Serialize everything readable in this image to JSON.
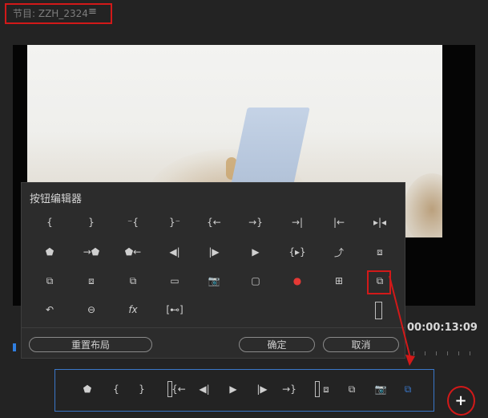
{
  "header": {
    "title": "节目: ZZH_2324",
    "menu_icon": "hamburger-menu-icon"
  },
  "monitor": {
    "timecode": "00:00:13:09"
  },
  "dialog": {
    "title": "按钮编辑器",
    "reset_label": "重置布局",
    "ok_label": "确定",
    "cancel_label": "取消",
    "fx_label": "fx",
    "buttons": [
      {
        "icon": "add-marker-in-icon",
        "glyph": "{"
      },
      {
        "icon": "add-marker-out-icon",
        "glyph": "}"
      },
      {
        "icon": "clear-in-icon",
        "glyph": "⁻{"
      },
      {
        "icon": "clear-out-icon",
        "glyph": "}⁻"
      },
      {
        "icon": "go-to-in-icon",
        "glyph": "{←"
      },
      {
        "icon": "go-to-out-icon",
        "glyph": "→}"
      },
      {
        "icon": "go-to-next-edit-icon",
        "glyph": "→|"
      },
      {
        "icon": "go-to-prev-edit-icon",
        "glyph": "|←"
      },
      {
        "icon": "trim-edit-icon",
        "glyph": "▸|◂"
      },
      {
        "icon": "add-marker-icon",
        "glyph": "⬟"
      },
      {
        "icon": "go-to-next-marker-icon",
        "glyph": "→⬟"
      },
      {
        "icon": "go-to-prev-marker-icon",
        "glyph": "⬟←"
      },
      {
        "icon": "step-back-icon",
        "glyph": "◀|"
      },
      {
        "icon": "step-forward-icon",
        "glyph": "|▶"
      },
      {
        "icon": "play-icon",
        "glyph": "▶"
      },
      {
        "icon": "play-in-to-out-icon",
        "glyph": "{▸}"
      },
      {
        "icon": "play-around-icon",
        "glyph": "⤴"
      },
      {
        "icon": "lift-icon",
        "glyph": "⧈"
      },
      {
        "icon": "extract-icon",
        "glyph": "⧉"
      },
      {
        "icon": "insert-icon",
        "glyph": "⧈"
      },
      {
        "icon": "overwrite-icon",
        "glyph": "⧉"
      },
      {
        "icon": "safe-margins-icon",
        "glyph": "▭"
      },
      {
        "icon": "export-frame-icon",
        "glyph": "📷"
      },
      {
        "icon": "closed-captions-icon",
        "glyph": "▢"
      },
      {
        "icon": "record-icon",
        "glyph": "●"
      },
      {
        "icon": "multi-camera-icon",
        "glyph": "⊞"
      },
      {
        "icon": "comparison-view-icon",
        "glyph": "⧉"
      },
      {
        "icon": "undo-icon",
        "glyph": "↶"
      },
      {
        "icon": "vr-video-icon",
        "glyph": "⊖"
      },
      {
        "icon": "fx-bypass-icon",
        "glyph": "fx"
      },
      {
        "icon": "drop-frame-icon",
        "glyph": "[⊷]"
      }
    ]
  },
  "control_bar": {
    "items": [
      {
        "icon": "add-marker-icon",
        "glyph": "⬟"
      },
      {
        "icon": "mark-in-icon",
        "glyph": "{"
      },
      {
        "icon": "mark-out-icon",
        "glyph": "}"
      },
      {
        "icon": "spacer-icon",
        "glyph": ""
      },
      {
        "icon": "go-to-in-icon",
        "glyph": "{←"
      },
      {
        "icon": "step-back-icon",
        "glyph": "◀|"
      },
      {
        "icon": "play-icon",
        "glyph": "▶"
      },
      {
        "icon": "step-forward-icon",
        "glyph": "|▶"
      },
      {
        "icon": "go-to-out-icon",
        "glyph": "→}"
      },
      {
        "icon": "spacer-icon",
        "glyph": ""
      },
      {
        "icon": "insert-icon",
        "glyph": "⧈"
      },
      {
        "icon": "overwrite-icon",
        "glyph": "⧉"
      },
      {
        "icon": "export-frame-icon",
        "glyph": "📷"
      },
      {
        "icon": "comparison-view-icon",
        "glyph": "⧉"
      }
    ]
  },
  "colors": {
    "accent": "#3a77c9",
    "highlight_red": "#d21919",
    "record_red": "#e53935"
  }
}
